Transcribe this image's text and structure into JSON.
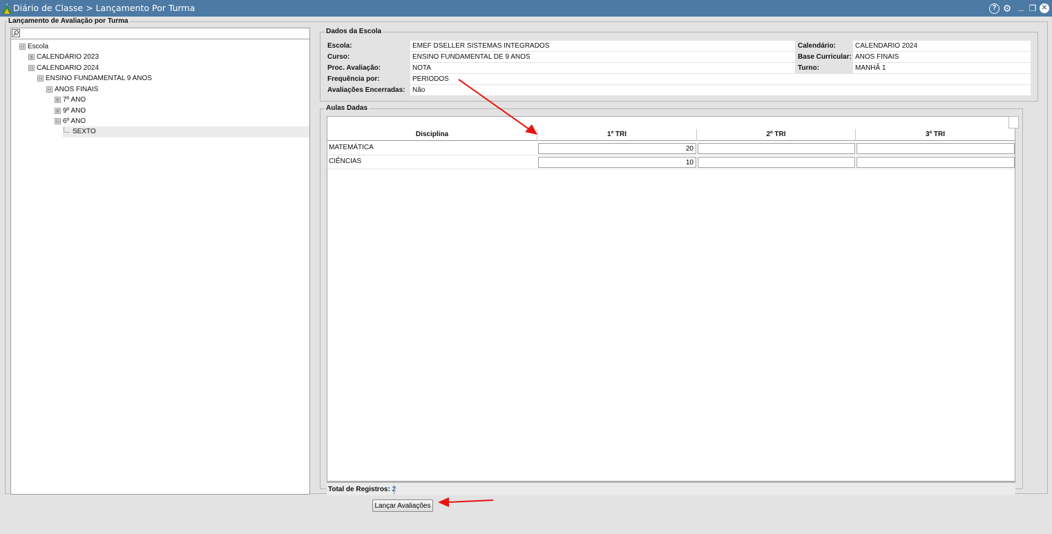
{
  "window": {
    "title": "Diário de Classe > Lançamento Por Turma",
    "controls": [
      "help-icon",
      "gear-icon",
      "minimize-icon",
      "restore-icon",
      "close-icon"
    ]
  },
  "left_panel": {
    "legend": "Lançamento de Avaliação por Turma",
    "search_icon": "search-icon",
    "tree": [
      {
        "label": "Escola",
        "toggle": "⊟"
      },
      {
        "label": "CALENDÁRIO 2023",
        "toggle": "⊞"
      },
      {
        "label": "CALENDARIO 2024",
        "toggle": "⊟"
      },
      {
        "label": "ENSINO FUNDAMENTAL 9 ANOS",
        "toggle": "⊟"
      },
      {
        "label": "ANOS FINAIS",
        "toggle": "⊟"
      },
      {
        "label": "7º ANO",
        "toggle": "⊞"
      },
      {
        "label": "9º ANO",
        "toggle": "⊞"
      },
      {
        "label": "6º ANO",
        "toggle": "⊟"
      },
      {
        "label": "SEXTO",
        "toggle": ""
      }
    ]
  },
  "dados_escola": {
    "legend": "Dados da Escola",
    "fields": [
      {
        "label": "Escola:",
        "value": "EMEF DSELLER SISTEMAS INTEGRADOS"
      },
      {
        "label": "Curso:",
        "value": "ENSINO FUNDAMENTAL DE 9 ANOS"
      },
      {
        "label": "Proc. Avaliação:",
        "value": "NOTA"
      },
      {
        "label": "Frequência por:",
        "value": "PERIODOS"
      },
      {
        "label": "Avaliações Encerradas:",
        "value": "Não"
      }
    ],
    "right_fields": [
      {
        "label": "Calendário:",
        "value": "CALENDARIO 2024"
      },
      {
        "label": "Base Curricular:",
        "value": "ANOS FINAIS"
      },
      {
        "label": "Turno:",
        "value": "MANHÃ 1"
      }
    ]
  },
  "aulas_dadas": {
    "legend": "Aulas Dadas",
    "columns": [
      "Disciplina",
      "1º TRI",
      "2º TRI",
      "3º TRI"
    ],
    "rows": [
      {
        "disciplina": "MATEMÁTICA",
        "tri1": "20",
        "tri2": "",
        "tri3": ""
      },
      {
        "disciplina": "CIÊNCIAS",
        "tri1": "10",
        "tri2": "",
        "tri3": ""
      }
    ],
    "footer_label": "Total de Registros:",
    "footer_count": "2"
  },
  "actions": {
    "lancar_label": "Lançar Avaliações"
  },
  "colors": {
    "titlebar": "#4d7aa4",
    "annotation_arrow": "#e8130f",
    "count_blue": "#1560bd"
  }
}
